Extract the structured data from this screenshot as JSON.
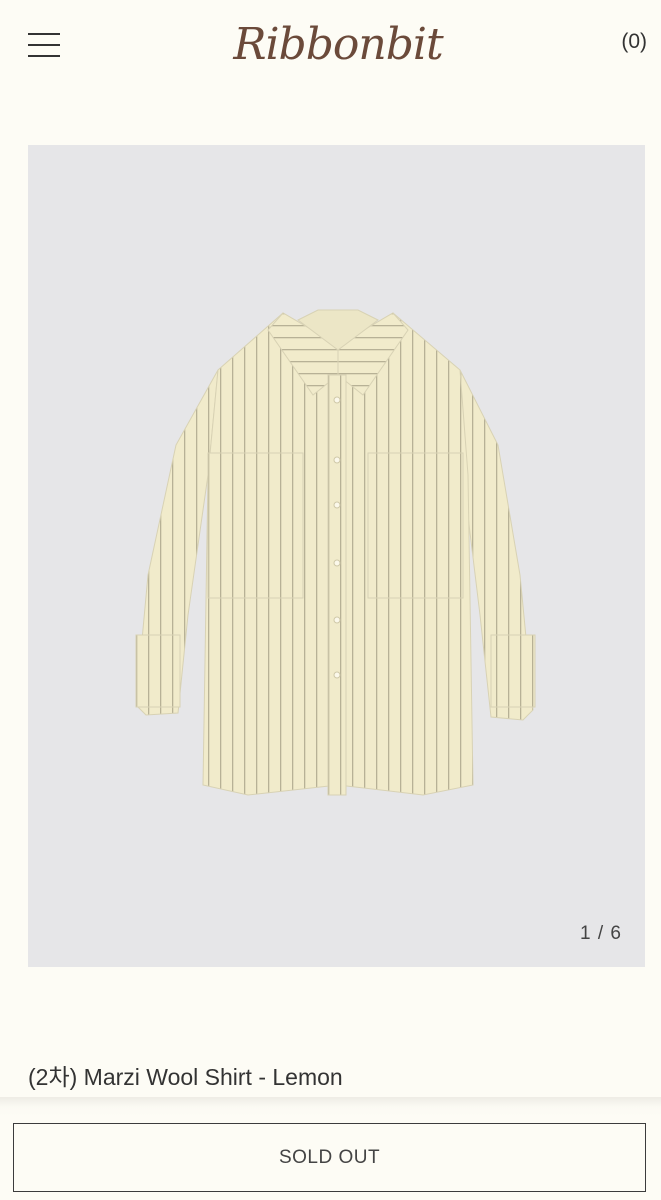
{
  "header": {
    "logo_text": "Ribbonbit",
    "cart_label": "(0)",
    "menu_icon": "hamburger-menu-icon"
  },
  "gallery": {
    "counter": "1 / 6",
    "image_subject": "striped button-up shirt",
    "shirt_color": "#f1ebcb",
    "stripe_color": "#b7b196"
  },
  "product": {
    "title": "(2차) Marzi Wool Shirt - Lemon"
  },
  "actions": {
    "sold_out_label": "SOLD OUT"
  }
}
